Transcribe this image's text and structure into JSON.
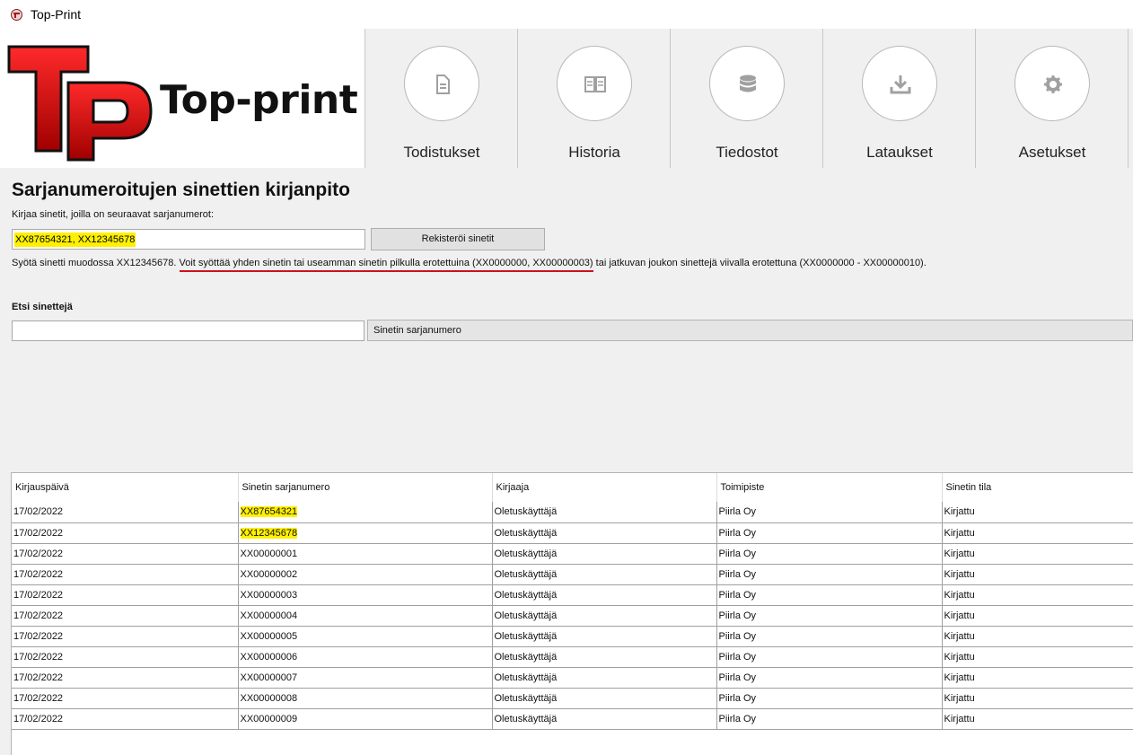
{
  "window": {
    "title": "Top-Print"
  },
  "logo": {
    "text": "Top-print"
  },
  "nav": [
    {
      "label": "Todistukset",
      "icon": "document-icon"
    },
    {
      "label": "Historia",
      "icon": "book-icon"
    },
    {
      "label": "Tiedostot",
      "icon": "database-icon"
    },
    {
      "label": "Lataukset",
      "icon": "download-icon"
    },
    {
      "label": "Asetukset",
      "icon": "gear-icon"
    }
  ],
  "page": {
    "title": "Sarjanumeroitujen sinettien kirjanpito",
    "register_label": "Kirjaa sinetit, joilla on seuraavat sarjanumerot:",
    "register_value": "XX87654321, XX12345678",
    "register_button": "Rekisteröi sinetit",
    "hint_prefix": "Syötä sinetti muodossa XX12345678. ",
    "hint_underlined": "Voit syöttää yhden sinetin tai useamman sinetin pilkulla erotettuina (XX0000000, XX00000003)",
    "hint_suffix": " tai jatkuvan joukon sinettejä viivalla erotettuna (XX0000000 -  XX00000010).",
    "search_label": "Etsi sinettejä",
    "search_value": "",
    "search_field_option": "Sinetin sarjanumero"
  },
  "table": {
    "columns": [
      "Kirjauspäivä",
      "Sinetin sarjanumero",
      "Kirjaaja",
      "Toimipiste",
      "Sinetin tila"
    ],
    "rows": [
      [
        "17/02/2022",
        "XX87654321",
        "Oletuskäyttäjä",
        "Piirla Oy",
        "Kirjattu"
      ],
      [
        "17/02/2022",
        "XX12345678",
        "Oletuskäyttäjä",
        "Piirla Oy",
        "Kirjattu"
      ],
      [
        "17/02/2022",
        "XX00000001",
        "Oletuskäyttäjä",
        "Piirla Oy",
        "Kirjattu"
      ],
      [
        "17/02/2022",
        "XX00000002",
        "Oletuskäyttäjä",
        "Piirla Oy",
        "Kirjattu"
      ],
      [
        "17/02/2022",
        "XX00000003",
        "Oletuskäyttäjä",
        "Piirla Oy",
        "Kirjattu"
      ],
      [
        "17/02/2022",
        "XX00000004",
        "Oletuskäyttäjä",
        "Piirla Oy",
        "Kirjattu"
      ],
      [
        "17/02/2022",
        "XX00000005",
        "Oletuskäyttäjä",
        "Piirla Oy",
        "Kirjattu"
      ],
      [
        "17/02/2022",
        "XX00000006",
        "Oletuskäyttäjä",
        "Piirla Oy",
        "Kirjattu"
      ],
      [
        "17/02/2022",
        "XX00000007",
        "Oletuskäyttäjä",
        "Piirla Oy",
        "Kirjattu"
      ],
      [
        "17/02/2022",
        "XX00000008",
        "Oletuskäyttäjä",
        "Piirla Oy",
        "Kirjattu"
      ],
      [
        "17/02/2022",
        "XX00000009",
        "Oletuskäyttäjä",
        "Piirla Oy",
        "Kirjattu"
      ]
    ]
  },
  "colors": {
    "highlight": "#fff000",
    "underline": "#d0101e",
    "logo_red": "#d0101e"
  }
}
